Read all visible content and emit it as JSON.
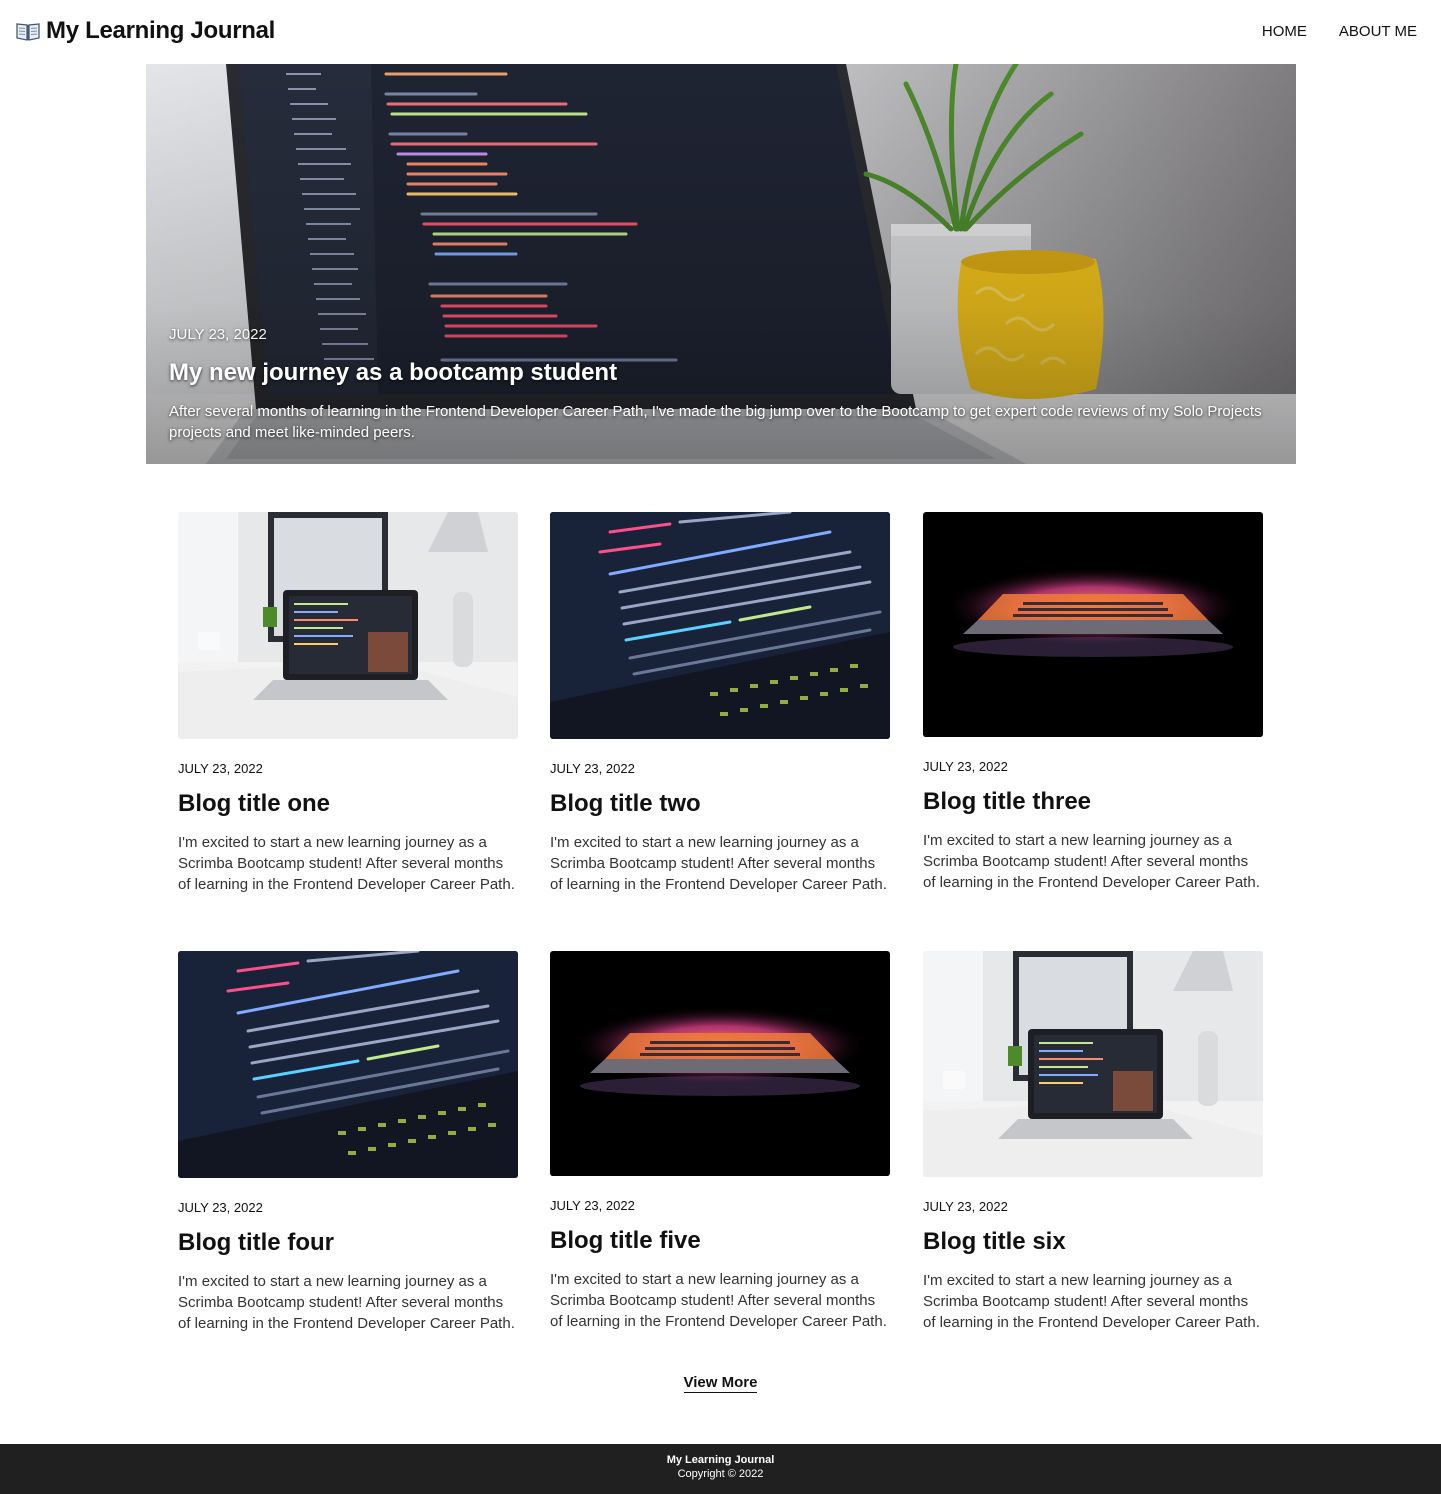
{
  "header": {
    "site_title": "My Learning Journal",
    "logo_icon": "open-book-icon",
    "nav": [
      {
        "label": "HOME"
      },
      {
        "label": "ABOUT ME"
      }
    ]
  },
  "hero": {
    "date": "JULY 23, 2022",
    "title": "My new journey as a bootcamp student",
    "description": "After several months of learning in the Frontend Developer Career Path, I've made the big jump over to the Bootcamp to get expert code reviews of my Solo Projects projects and meet like-minded peers."
  },
  "posts": [
    {
      "date": "JULY 23, 2022",
      "title": "Blog title one",
      "excerpt": "I'm excited to start a new learning journey as a Scrimba Bootcamp student! After several months of learning in the Frontend Developer Career Path."
    },
    {
      "date": "JULY 23, 2022",
      "title": "Blog title two",
      "excerpt": "I'm excited to start a new learning journey as a Scrimba Bootcamp student! After several months of learning in the Frontend Developer Career Path."
    },
    {
      "date": "JULY 23, 2022",
      "title": "Blog title three",
      "excerpt": "I'm excited to start a new learning journey as a Scrimba Bootcamp student! After several months of learning in the Frontend Developer Career Path."
    },
    {
      "date": "JULY 23, 2022",
      "title": "Blog title four",
      "excerpt": "I'm excited to start a new learning journey as a Scrimba Bootcamp student! After several months of learning in the Frontend Developer Career Path."
    },
    {
      "date": "JULY 23, 2022",
      "title": "Blog title five",
      "excerpt": "I'm excited to start a new learning journey as a Scrimba Bootcamp student! After several months of learning in the Frontend Developer Career Path."
    },
    {
      "date": "JULY 23, 2022",
      "title": "Blog title six",
      "excerpt": "I'm excited to start a new learning journey as a Scrimba Bootcamp student! After several months of learning in the Frontend Developer Career Path."
    }
  ],
  "view_more": "View More",
  "footer": {
    "title": "My Learning Journal",
    "copyright": "Copyright © 2022"
  }
}
